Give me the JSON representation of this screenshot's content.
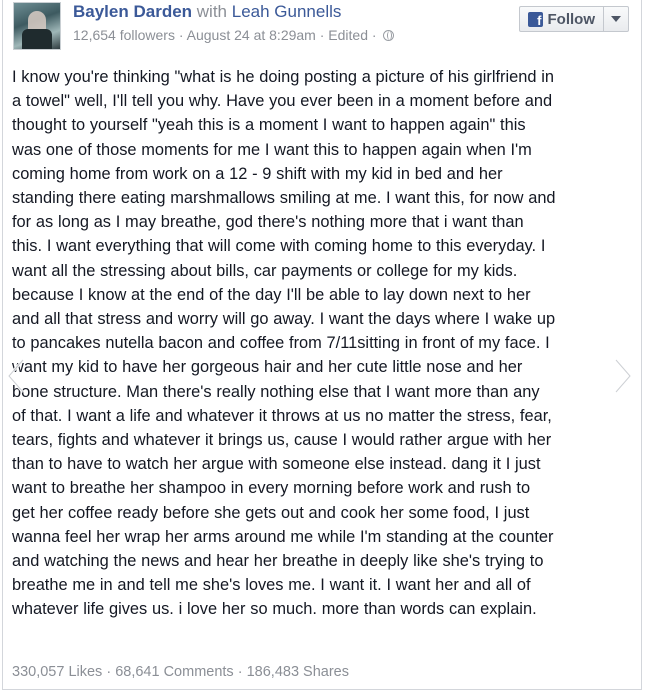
{
  "post": {
    "author": "Baylen Darden",
    "with_word": "with",
    "tagged": "Leah Gunnells",
    "followers": "12,654 followers",
    "date": "August 24 at 8:29am",
    "edited": "Edited",
    "sep": "·",
    "follow_label": "Follow",
    "body": "I know you're thinking \"what is he doing posting a picture of his girlfriend in\na towel\" well, I'll tell you why. Have you ever been in a moment before and\nthought to yourself \"yeah this is a moment I want to happen again\" this\nwas one of those moments for me I want this to happen again when I'm\ncoming home from work on a 12 - 9 shift with my kid in bed and her\nstanding there eating marshmallows smiling at me. I want this, for now and\nfor as long as I may breathe, god there's nothing more that i want than\nthis. I want everything that will come with coming home to this everyday. I\nwant all the stressing about bills, car payments or college for my kids.\nbecause I know at the end of the day I'll be able to lay down next to her\nand all that stress and worry will go away. I want the days where I wake up\nto pancakes nutella bacon and coffee from 7/11sitting in front of my face. I\nwant my kid to have her gorgeous hair and her cute little nose and her\nbone structure. Man there's really nothing else that I want more than any\nof that. I want a life and whatever it throws at us no matter the stress, fear,\ntears, fights and whatever it brings us, cause I would rather argue with her\nthan to have to watch her argue with someone else instead. dang it I just\nwant to breathe her shampoo in every morning before work and rush to\nget her coffee ready before she gets out and cook her some food, I just\nwanna feel her wrap her arms around me while I'm standing at the counter\nand watching the news and hear her breathe in deeply like she's trying to\nbreathe me in and tell me she's loves me. I want it. I want her and all of\nwhatever life gives us. i love her so much. more than words can explain.",
    "likes": "330,057 Likes",
    "comments": "68,641 Comments",
    "shares": "186,483 Shares"
  },
  "icons": {
    "facebook": "facebook-f-icon",
    "dropdown": "chevron-down-icon",
    "privacy": "globe-icon",
    "prev": "chevron-left-icon",
    "next": "chevron-right-icon"
  },
  "colors": {
    "link": "#3b5998",
    "meta": "#8b8f96",
    "text": "#141823"
  }
}
